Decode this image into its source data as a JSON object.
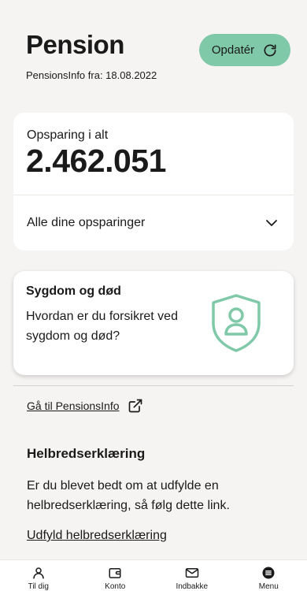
{
  "header": {
    "title": "Pension",
    "subtitle": "PensionsInfo fra: 18.08.2022",
    "update_label": "Opdatér"
  },
  "savings": {
    "label": "Opsparing i alt",
    "value": "2.462.051",
    "all_label": "Alle dine opsparinger"
  },
  "insurance": {
    "title": "Sygdom og død",
    "text": "Hvordan er du forsikret ved sygdom og død?"
  },
  "pensionsinfo_link": "Gå til PensionsInfo",
  "health": {
    "title": "Helbredserklæring",
    "text": "Er du blevet bedt om at udfylde en helbredserklæring, så følg dette link.",
    "link": "Udfyld helbredserklæring"
  },
  "nav": {
    "items": [
      {
        "label": "Til dig",
        "icon": "person-icon"
      },
      {
        "label": "Konto",
        "icon": "wallet-icon"
      },
      {
        "label": "Indbakke",
        "icon": "mail-icon"
      },
      {
        "label": "Menu",
        "icon": "menu-icon"
      }
    ]
  },
  "colors": {
    "accent": "#7fc9a8",
    "shield": "#7fc9a8",
    "background": "#f6f4f3"
  }
}
